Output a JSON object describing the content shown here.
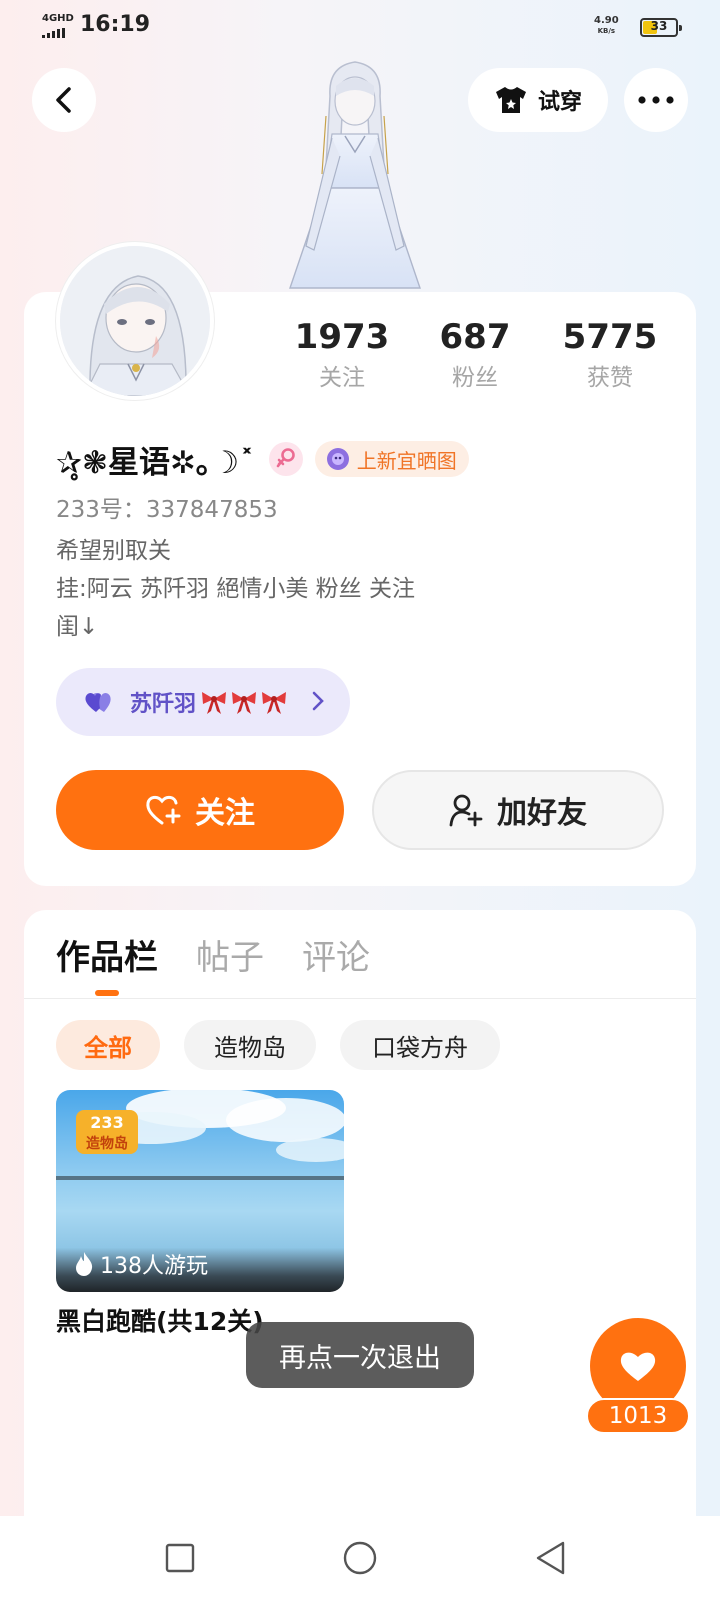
{
  "status_bar": {
    "network": "4GHD",
    "time": "16:19",
    "speed_value": "4.90",
    "speed_unit": "KB/s",
    "battery": "33"
  },
  "header": {
    "back_icon": "chevron-left-icon",
    "try_on_label": "试穿",
    "try_on_icon": "tshirt-icon",
    "more_icon": "ellipsis-icon"
  },
  "profile": {
    "stats": [
      {
        "value": "1973",
        "label": "关注"
      },
      {
        "value": "687",
        "label": "粉丝"
      },
      {
        "value": "5775",
        "label": "获赞"
      }
    ],
    "nickname": "✰̥❃星语✲｡☽˟",
    "gender": "female",
    "title_badge": "上新宜晒图",
    "user_id": "233号：337847853",
    "bio_lines": [
      "希望别取关",
      "挂:阿云 苏阡羽 絕情小美 粉丝 关注",
      "闺↓"
    ],
    "bestie": {
      "name": "苏阡羽",
      "bow_count": 3
    },
    "follow_label": "关注",
    "add_friend_label": "加好友"
  },
  "works": {
    "tabs": [
      {
        "label": "作品栏",
        "active": true
      },
      {
        "label": "帖子",
        "active": false
      },
      {
        "label": "评论",
        "active": false
      }
    ],
    "filters": [
      {
        "label": "全部",
        "active": true
      },
      {
        "label": "造物岛",
        "active": false
      },
      {
        "label": "口袋方舟",
        "active": false
      }
    ],
    "items": [
      {
        "title": "黑白跑酷(共12关)",
        "plays": "138人游玩",
        "logo_text": "233 造物岛"
      }
    ]
  },
  "toast": "再点一次退出",
  "like": {
    "count": "1013"
  },
  "colors": {
    "accent": "#ff7110",
    "bestie_bg": "#ebe9fb",
    "bestie_text": "#6152c7"
  }
}
